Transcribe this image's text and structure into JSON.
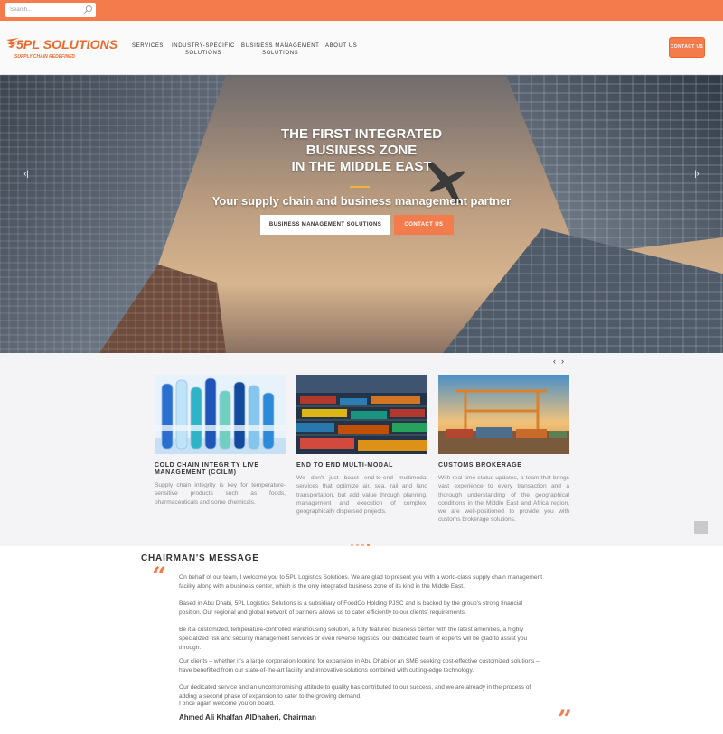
{
  "search": {
    "placeholder": "Search..."
  },
  "logo": {
    "name": "5PL SOLUTIONS",
    "tagline": "SUPPLY CHAIN REDEFINED"
  },
  "nav": {
    "services": "SERVICES",
    "industry_1": "INDUSTRY-SPECIFIC",
    "industry_2": "SOLUTIONS",
    "business_1": "BUSINESS MANAGEMENT",
    "business_2": "SOLUTIONS",
    "about": "ABOUT US"
  },
  "header": {
    "contact_label": "CONTACT US"
  },
  "hero": {
    "title_1": "THE FIRST INTEGRATED",
    "title_2": "BUSINESS ZONE",
    "title_3": "IN THE MIDDLE EAST",
    "subtitle": "Your supply chain and business management partner",
    "button_primary": "BUSINESS MANAGEMENT SOLUTIONS",
    "button_secondary": "CONTACT US",
    "prev_glyph": "‹|",
    "next_glyph": "|›"
  },
  "services": {
    "prev_glyph": "‹",
    "next_glyph": "›",
    "cards": [
      {
        "title": "COLD CHAIN INTEGRITY LIVE MANAGEMENT (CCILM)",
        "text": "Supply chain integrity is key for temperature-sensitive products such as foods, pharmaceuticals and some chemicals."
      },
      {
        "title": "END TO END MULTI-MODAL",
        "text": "We don't just boast end-to-end multimodal services that optimize air, sea, rail and land transportation, but add value through planning, management and execution of complex, geographically dispersed projects."
      },
      {
        "title": "CUSTOMS BROKERAGE",
        "text": "With real-time status updates, a team that brings vast experience to every transaction and a thorough understanding of the geographical conditions in the Middle East and Africa region, we are well-positioned to provide you with customs brokerage solutions."
      }
    ],
    "carousel_active_index": 3
  },
  "chairman": {
    "heading": "CHAIRMAN'S MESSAGE",
    "open_quote": "“",
    "close_quote": "”",
    "paragraphs": [
      "On behalf of our team, I welcome you to 5PL Logistics Solutions. We are glad to present you with a world-class supply chain management facility along with a business center, which is the only integrated business zone of its kind in the Middle East.",
      "Based in Abu Dhabi, 5PL Logistics Solutions is a subsidiary of FoodCo Holding PJSC and is backed by the group's strong financial position. Our regional and global network of partners allows us to cater efficiently to our clients' requirements.",
      "Be it a customized, temperature-controlled warehousing solution, a fully featured business center with the latest amenities, a highly specialized risk and security management services or even reverse logistics, our dedicated team of experts will be glad to assist you through.",
      "Our clients – whether it's a large corporation looking for expansion in Abu Dhabi or an SME seeking cost-effective customized solutions – have benefitted from our state-of-the-art facility and innovative solutions combined with cutting-edge technology.",
      "Our dedicated service and an uncompromising attitude to quality has contributed to our success, and we are already in the process of adding a second phase of expansion to cater to the growing demand.",
      "I once again welcome you on board."
    ],
    "signature": "Ahmed Ali Khalfan AlDhaheri, Chairman"
  },
  "colors": {
    "accent": "#f47c4c",
    "accent_dark": "#ea6a2c",
    "hero_rule": "#f0b23d"
  },
  "icons": [
    "search-icon",
    "logo-swoosh-icon",
    "chevron-left-icon",
    "chevron-right-icon",
    "quote-icon",
    "scroll-top-icon"
  ]
}
